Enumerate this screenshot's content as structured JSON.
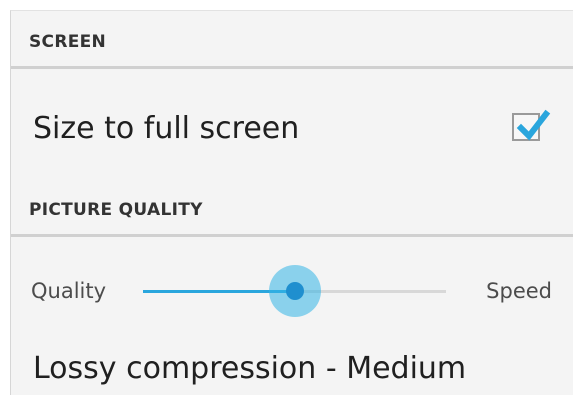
{
  "sections": {
    "screen": {
      "title": "SCREEN"
    },
    "picture_quality": {
      "title": "PICTURE QUALITY"
    }
  },
  "full_screen": {
    "label": "Size to full screen",
    "checked": true
  },
  "quality_slider": {
    "left_label": "Quality",
    "right_label": "Speed",
    "value_fraction": 0.5
  },
  "compression": {
    "label": "Lossy compression - Medium"
  },
  "colors": {
    "accent": "#33b5e5",
    "accent_dark": "#1f8fcf"
  }
}
